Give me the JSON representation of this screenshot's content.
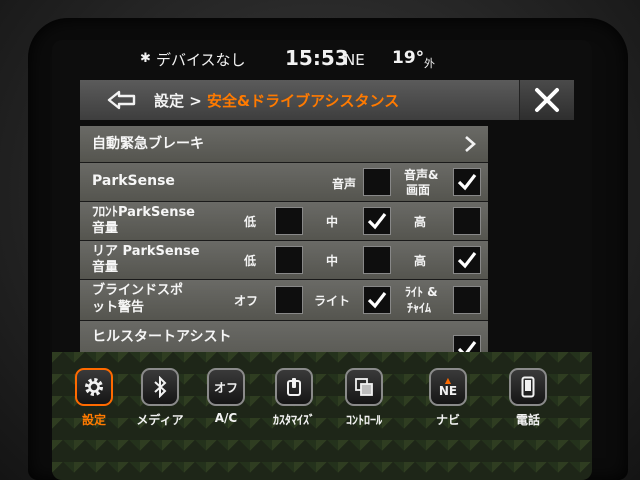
{
  "status": {
    "device": "デバイスなし",
    "time": "15:53",
    "direction": "NE",
    "temperature": "19°",
    "outside": "外"
  },
  "header": {
    "crumb_parent": "設定 > ",
    "crumb_current": "安全&ドライブアシスタンス"
  },
  "rows": {
    "aeb": {
      "label": "自動緊急ブレーキ"
    },
    "parksense": {
      "label": "ParkSense",
      "opt_sound": "音声",
      "opt_sound_display_1": "音声&",
      "opt_sound_display_2": "画面",
      "sound_checked": false,
      "sound_display_checked": true
    },
    "front_parksense": {
      "label_1": "ﾌﾛﾝﾄParkSense",
      "label_2": "音量",
      "opt_low": "低",
      "opt_mid": "中",
      "opt_high": "高",
      "selected": "中"
    },
    "rear_parksense": {
      "label_1": "リア ParkSense",
      "label_2": "音量",
      "opt_low": "低",
      "opt_mid": "中",
      "opt_high": "高",
      "selected": "高"
    },
    "blind_spot": {
      "label_1": "ブラインドスポ",
      "label_2": "ット警告",
      "opt_off": "オフ",
      "opt_light": "ライト",
      "opt_light_chime_1": "ﾗｲﾄ &",
      "opt_light_chime_2": "ﾁｬｲﾑ",
      "selected": "ライト"
    },
    "hill_start": {
      "label": "ヒルスタートアシスト",
      "checked": true
    }
  },
  "nav": {
    "settings": "設定",
    "media": "メディア",
    "ac_icon_text": "オフ",
    "ac": "A/C",
    "customize": "ｶｽﾀﾏｲｽﾞ",
    "controls": "ｺﾝﾄﾛｰﾙ",
    "nav_icon_text": "NE",
    "navi": "ナビ",
    "phone": "電話"
  },
  "colors": {
    "accent": "#ff7a00",
    "row_bg": "#5f5f5a",
    "header_bg": "#4a4a4a",
    "checkbox_bg": "#0e0e0e"
  },
  "icons": {
    "back": "back-arrow-icon",
    "close": "close-icon",
    "chevron": "chevron-right-icon",
    "check": "checkmark-icon",
    "gear": "gear-icon",
    "bluetooth": "bluetooth-icon",
    "customize": "customize-icon",
    "controls": "controls-icon",
    "phone": "phone-icon"
  }
}
